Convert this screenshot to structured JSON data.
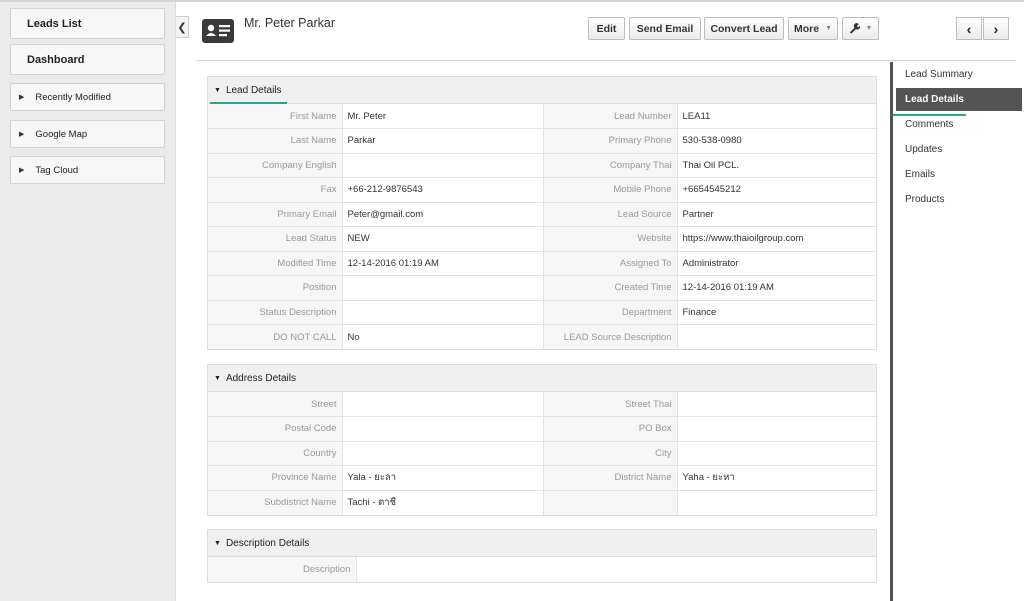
{
  "sidebar": {
    "leads_list": "Leads List",
    "dashboard": "Dashboard",
    "widgets": [
      {
        "label": "Recently Modified"
      },
      {
        "label": "Google Map"
      },
      {
        "label": "Tag Cloud"
      }
    ]
  },
  "header": {
    "title": "Mr. Peter Parkar",
    "buttons": {
      "edit": "Edit",
      "send_email": "Send Email",
      "convert_lead": "Convert Lead",
      "more": "More"
    }
  },
  "right_nav": {
    "items": [
      {
        "label": "Lead Summary"
      },
      {
        "label": "Lead Details"
      },
      {
        "label": "Comments"
      },
      {
        "label": "Updates"
      },
      {
        "label": "Emails"
      },
      {
        "label": "Products"
      }
    ]
  },
  "lead_details": {
    "title": "Lead Details",
    "rows": [
      {
        "l1": "First Name",
        "v1": "Mr. Peter",
        "l2": "Lead Number",
        "v2": "LEA11"
      },
      {
        "l1": "Last Name",
        "v1": "Parkar",
        "l2": "Primary Phone",
        "v2": "530-538-0980"
      },
      {
        "l1": "Company English",
        "v1": "",
        "l2": "Company Thai",
        "v2": "Thai Oil PCL."
      },
      {
        "l1": "Fax",
        "v1": "+66-212-9876543",
        "l2": "Mobile Phone",
        "v2": "+6654545212"
      },
      {
        "l1": "Primary Email",
        "v1": "Peter@gmail.com",
        "l2": "Lead Source",
        "v2": "Partner"
      },
      {
        "l1": "Lead Status",
        "v1": "NEW",
        "l2": "Website",
        "v2": "https://www.thaioilgroup.com"
      },
      {
        "l1": "Modified Time",
        "v1": "12-14-2016 01:19 AM",
        "l2": "Assigned To",
        "v2": "Administrator"
      },
      {
        "l1": "Position",
        "v1": "",
        "l2": "Created Time",
        "v2": "12-14-2016 01:19 AM"
      },
      {
        "l1": "Status Description",
        "v1": "",
        "l2": "Department",
        "v2": "Finance"
      },
      {
        "l1": "DO NOT CALL",
        "v1": "No",
        "l2": "LEAD Source Description",
        "v2": ""
      }
    ]
  },
  "address_details": {
    "title": "Address Details",
    "rows": [
      {
        "l1": "Street",
        "v1": "",
        "l2": "Street Thai",
        "v2": ""
      },
      {
        "l1": "Postal Code",
        "v1": "",
        "l2": "PO Box",
        "v2": ""
      },
      {
        "l1": "Country",
        "v1": "",
        "l2": "City",
        "v2": ""
      },
      {
        "l1": "Province Name",
        "v1": "Yala - ยะลา",
        "l2": "District Name",
        "v2": "Yaha - ยะหา"
      },
      {
        "l1": "Subdistrict Name",
        "v1": "Tachi - ตาชี",
        "l2": "",
        "v2": ""
      }
    ]
  },
  "description_details": {
    "title": "Description Details",
    "rows": [
      {
        "l1": "Description",
        "v1": ""
      }
    ]
  }
}
